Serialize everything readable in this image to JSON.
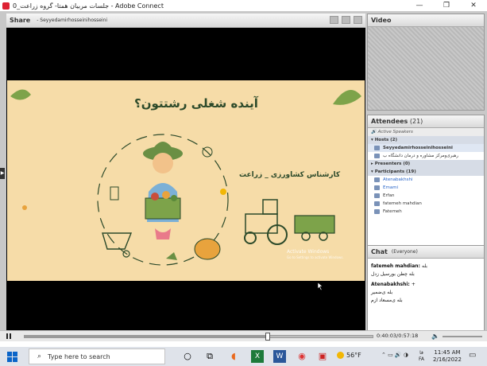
{
  "window": {
    "title": "جلسات مربیان همتا- گروه زراعت_0 - Adobe Connect",
    "controls": [
      "—",
      "❐",
      "✕"
    ]
  },
  "share_pod": {
    "title": "Share",
    "presenter": "- Seyyedamirhosseinihosseini"
  },
  "slide": {
    "title": "آینده شغلی رشتتون؟",
    "subtitle": "کارشناس کشاورزی _ زراعت",
    "watermark_line1": "Activate Windows",
    "watermark_line2": "Go to Settings to activate Windows."
  },
  "video_pod": {
    "title": "Video"
  },
  "attendees_pod": {
    "title": "Attendees",
    "count": "(21)",
    "active_speakers": "Active Speakers",
    "hosts_label": "Hosts (2)",
    "hosts": [
      "Seyyedamirhosseinihosseini",
      "رهبری‌ومرکز مشاوره و درمان دانشگاه ب"
    ],
    "presenters_label": "Presenters (0)",
    "participants_label": "Participants (19)",
    "participants": [
      "Atenabakhshi",
      "Emami",
      "Erfan",
      "fatemeh mahdian",
      "Fatemeh"
    ]
  },
  "chat_pod": {
    "title": "Chat",
    "scope": "(Everyone)",
    "messages": [
      {
        "author": "fatemeh mahdian:",
        "text": "بله",
        "lines": [
          "بله چطن بورسیل زدل"
        ]
      },
      {
        "author": "Atenabakhshi:",
        "text": "+",
        "lines": [
          "بله ی‌ضمیر",
          "بله ی‌مسعاد ازم"
        ]
      }
    ]
  },
  "playback": {
    "time": "0:40:03/0:57:18",
    "progress": 0.699
  },
  "taskbar": {
    "search_placeholder": "Type here to search",
    "weather": "56°F",
    "lang": "FA",
    "lang_top": "فا",
    "time": "11:45 AM",
    "date": "2/16/2022"
  },
  "colors": {
    "slide_bg": "#f6dca8",
    "slide_text": "#2c4a2a",
    "link_blue": "#2a66c9"
  }
}
